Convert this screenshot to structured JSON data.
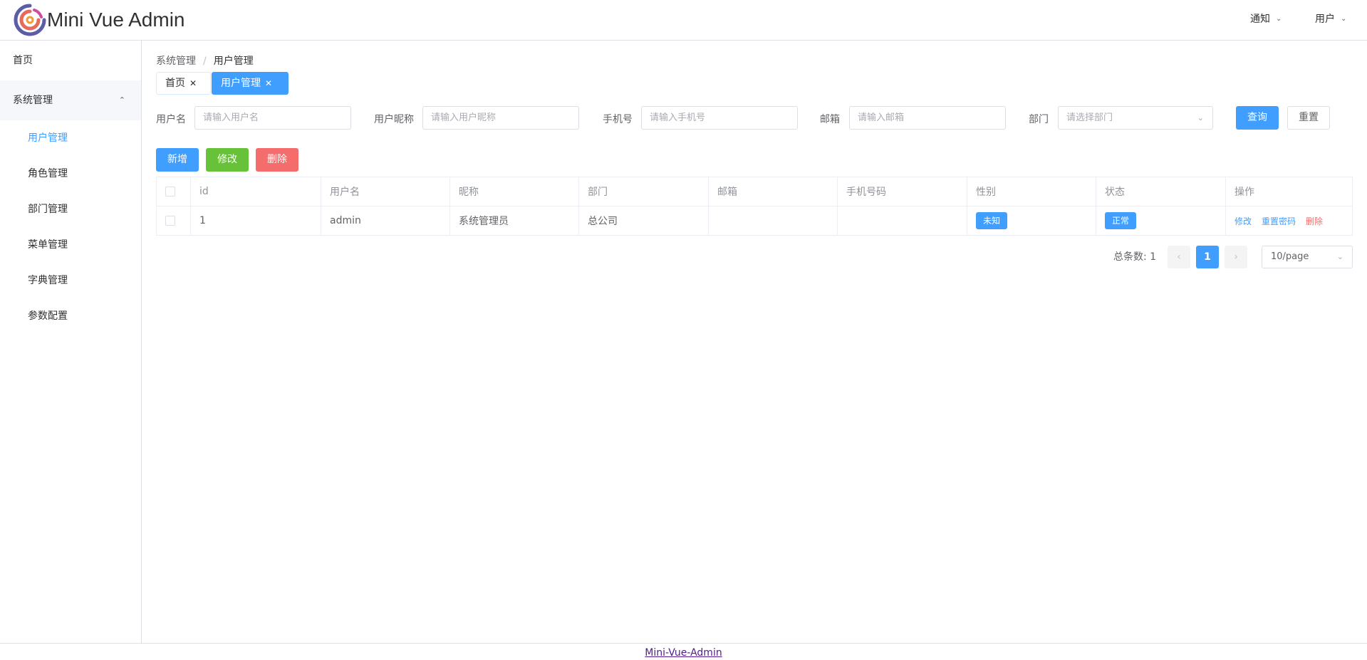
{
  "header": {
    "title": "Mini Vue Admin",
    "notify_label": "通知",
    "user_label": "用户",
    "logo_icon": "swirl-logo-icon"
  },
  "sidebar": {
    "home_label": "首页",
    "group_label": "系统管理",
    "sub_items": [
      {
        "label": "用户管理",
        "active": true
      },
      {
        "label": "角色管理",
        "active": false
      },
      {
        "label": "部门管理",
        "active": false
      },
      {
        "label": "菜单管理",
        "active": false
      },
      {
        "label": "字典管理",
        "active": false
      },
      {
        "label": "参数配置",
        "active": false
      }
    ]
  },
  "breadcrumb": {
    "parent": "系统管理",
    "separator": "/",
    "current": "用户管理"
  },
  "tabs": [
    {
      "label": "首页",
      "active": false
    },
    {
      "label": "用户管理",
      "active": true
    }
  ],
  "search_form": {
    "username_label": "用户名",
    "username_placeholder": "请输入用户名",
    "nickname_label": "用户昵称",
    "nickname_placeholder": "请输入用户昵称",
    "phone_label": "手机号",
    "phone_placeholder": "请输入手机号",
    "email_label": "邮箱",
    "email_placeholder": "请输入邮箱",
    "dept_label": "部门",
    "dept_placeholder": "请选择部门",
    "search_button": "查询",
    "reset_button": "重置"
  },
  "toolbar": {
    "add_label": "新增",
    "edit_label": "修改",
    "delete_label": "删除"
  },
  "table": {
    "columns": [
      "id",
      "用户名",
      "昵称",
      "部门",
      "邮箱",
      "手机号码",
      "性别",
      "状态",
      "操作"
    ],
    "rows": [
      {
        "id": "1",
        "username": "admin",
        "nickname": "系统管理员",
        "dept": "总公司",
        "email": "",
        "phone": "",
        "gender": "未知",
        "status": "正常",
        "actions": {
          "edit": "修改",
          "reset_password": "重置密码",
          "delete": "删除"
        }
      }
    ]
  },
  "pagination": {
    "total_label": "总条数: 1",
    "prev_icon": "chevron-left-icon",
    "current_page": "1",
    "next_icon": "chevron-right-icon",
    "page_size": "10/page"
  },
  "footer": {
    "link_text": "Mini-Vue-Admin"
  },
  "colors": {
    "primary": "#409eff",
    "success": "#67c23a",
    "danger": "#f56c6c"
  }
}
